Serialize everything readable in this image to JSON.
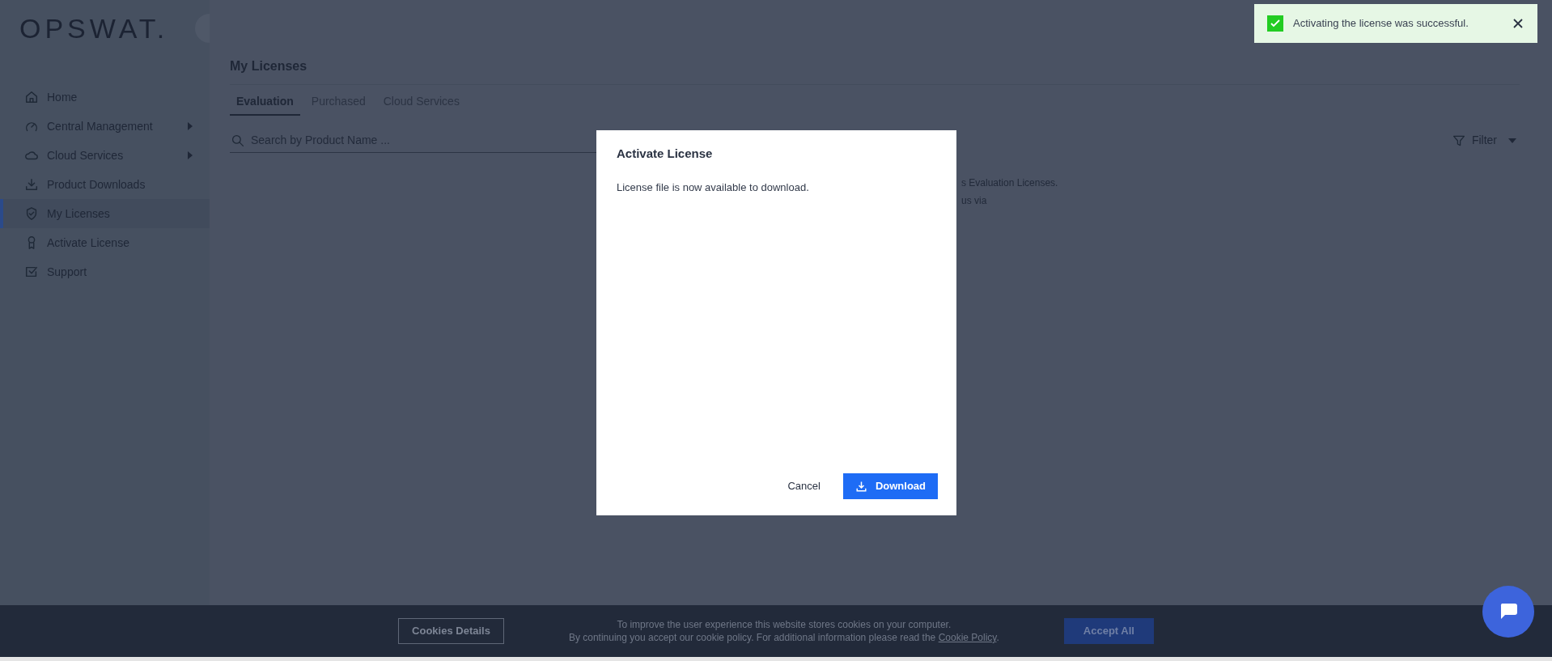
{
  "logo": "OPSWAT.",
  "sidebar": {
    "items": [
      {
        "label": "Home",
        "has_submenu": false,
        "selected": false
      },
      {
        "label": "Central Management",
        "has_submenu": true,
        "selected": false
      },
      {
        "label": "Cloud Services",
        "has_submenu": true,
        "selected": false
      },
      {
        "label": "Product Downloads",
        "has_submenu": false,
        "selected": false
      },
      {
        "label": "My Licenses",
        "has_submenu": false,
        "selected": true
      },
      {
        "label": "Activate License",
        "has_submenu": false,
        "selected": false
      },
      {
        "label": "Support",
        "has_submenu": false,
        "selected": false
      }
    ]
  },
  "page": {
    "title": "My Licenses",
    "tabs": [
      {
        "label": "Evaluation",
        "selected": true
      },
      {
        "label": "Purchased",
        "selected": false
      },
      {
        "label": "Cloud Services",
        "selected": false
      }
    ],
    "search": {
      "placeholder": "Search by Product Name ..."
    },
    "filter": "Filter",
    "message_fragments": [
      "s Evaluation Licenses.",
      "us via"
    ]
  },
  "toast": {
    "message": "Activating the license was successful."
  },
  "dialog": {
    "title": "Activate License",
    "message": "License file is now available to download.",
    "buttons": [
      {
        "label": "Cancel",
        "kind": "text"
      },
      {
        "label": "Download",
        "kind": "primary"
      }
    ]
  },
  "cookie_bar": {
    "details_button": "Cookies Details",
    "line_1": "To improve the user experience this website stores cookies on your computer.",
    "line_2": "By continuing you accept our cookie policy. For additional information please read the ",
    "link": "Cookie Policy",
    "line_2_end": ".",
    "accept_button": "Accept All"
  }
}
